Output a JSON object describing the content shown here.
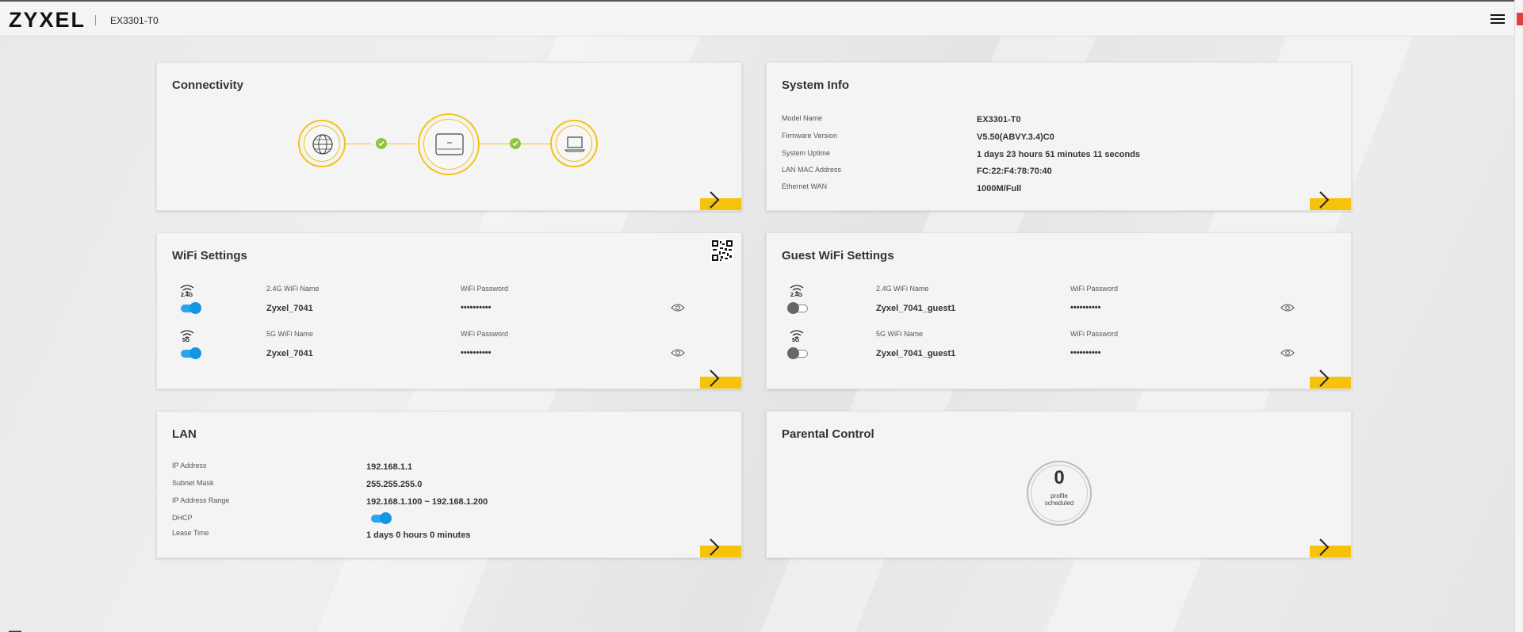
{
  "header": {
    "logo": "ZYXEL",
    "model": "EX3301-T0"
  },
  "connectivity": {
    "title": "Connectivity"
  },
  "system_info": {
    "title": "System Info",
    "rows": [
      {
        "label": "Model Name",
        "value": "EX3301-T0"
      },
      {
        "label": "Firmware Version",
        "value": "V5.50(ABVY.3.4)C0"
      },
      {
        "label": "System Uptime",
        "value": "1 days 23 hours 51 minutes 11 seconds"
      },
      {
        "label": "LAN MAC Address",
        "value": "FC:22:F4:78:70:40"
      },
      {
        "label": "Ethernet WAN",
        "value": "1000M/Full"
      }
    ]
  },
  "wifi": {
    "title": "WiFi Settings",
    "bands": [
      {
        "band": "2.4G",
        "name_label": "2.4G WiFi Name",
        "name": "Zyxel_7041",
        "pw_label": "WiFi Password",
        "pw": "••••••••••",
        "enabled": true
      },
      {
        "band": "5G",
        "name_label": "5G WiFi Name",
        "name": "Zyxel_7041",
        "pw_label": "WiFi Password",
        "pw": "••••••••••",
        "enabled": true
      }
    ]
  },
  "guest_wifi": {
    "title": "Guest WiFi Settings",
    "bands": [
      {
        "band": "2.4G",
        "name_label": "2.4G WiFi Name",
        "name": "Zyxel_7041_guest1",
        "pw_label": "WiFi Password",
        "pw": "••••••••••",
        "enabled": false
      },
      {
        "band": "5G",
        "name_label": "5G WiFi Name",
        "name": "Zyxel_7041_guest1",
        "pw_label": "WiFi Password",
        "pw": "••••••••••",
        "enabled": false
      }
    ]
  },
  "lan": {
    "title": "LAN",
    "ip_label": "IP Address",
    "ip": "192.168.1.1",
    "mask_label": "Subnet Mask",
    "mask": "255.255.255.0",
    "range_label": "IP Address Range",
    "range": "192.168.1.100 ~ 192.168.1.200",
    "dhcp_label": "DHCP",
    "dhcp_enabled": true,
    "lease_label": "Lease Time",
    "lease": "1 days 0 hours 0 minutes"
  },
  "parental": {
    "title": "Parental Control",
    "count": "0",
    "sub1": "profile",
    "sub2": "scheduled"
  },
  "colors": {
    "accent": "#f7c20a",
    "toggle_on": "#1795e0",
    "ok": "#8cc63f"
  }
}
